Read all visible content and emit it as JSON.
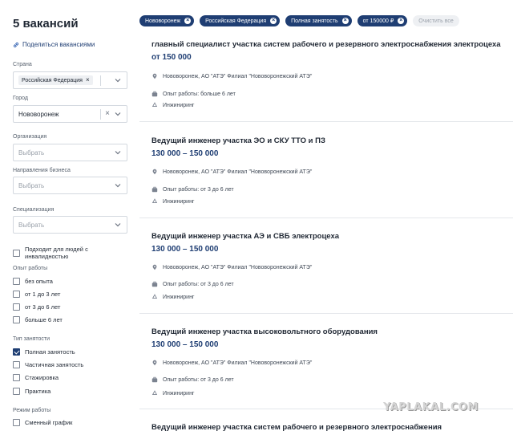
{
  "sidebar": {
    "count_title": "5 вакансий",
    "share_label": "Поделиться вакансиями",
    "country": {
      "label": "Страна",
      "chip": "Российская Федерация"
    },
    "city": {
      "label": "Город",
      "value": "Нововоронеж"
    },
    "organization": {
      "label": "Организация",
      "placeholder": "Выбрать"
    },
    "business": {
      "label": "Направления бизнеса",
      "placeholder": "Выбрать"
    },
    "specialization": {
      "label": "Специализация",
      "placeholder": "Выбрать"
    },
    "disability_label": "Подходит для людей с инвалидностью",
    "experience": {
      "title": "Опыт работы",
      "options": [
        "без опыта",
        "от 1 до 3 лет",
        "от 3 до 6 лет",
        "больше 6 лет"
      ]
    },
    "employment": {
      "title": "Тип занятости",
      "options": [
        "Полная занятость",
        "Частичная занятость",
        "Стажировка",
        "Практика"
      ]
    },
    "schedule": {
      "title": "Режим работы",
      "options": [
        "Сменный график"
      ]
    }
  },
  "chips": [
    "Нововоронеж",
    "Российская Федерация",
    "Полная занятость",
    "от 150000 ₽"
  ],
  "clear_all": "Очистить все",
  "jobs": [
    {
      "title": "главный специалист участка систем рабочего и резервного электроснабжения электроцеха",
      "salary": "от 150 000",
      "location": "Нововоронеж, АО \"АТЭ\" Филиал \"Нововоронежский АТЭ\"",
      "experience": "Опыт работы: больше 6 лет",
      "category": "Инжиниринг"
    },
    {
      "title": "Ведущий инженер участка ЭО и СКУ ТТО и ПЗ",
      "salary": "130 000 – 150 000",
      "location": "Нововоронеж, АО \"АТЭ\" Филиал \"Нововоронежский АТЭ\"",
      "experience": "Опыт работы: от 3 до 6 лет",
      "category": "Инжиниринг"
    },
    {
      "title": "Ведущий инженер участка АЭ и СВБ электроцеха",
      "salary": "130 000 – 150 000",
      "location": "Нововоронеж, АО \"АТЭ\" Филиал \"Нововоронежский АТЭ\"",
      "experience": "Опыт работы: от 3 до 6 лет",
      "category": "Инжиниринг"
    },
    {
      "title": "Ведущий инженер участка высоковольтного оборудования",
      "salary": "130 000 – 150 000",
      "location": "Нововоронеж, АО \"АТЭ\" Филиал \"Нововоронежский АТЭ\"",
      "experience": "Опыт работы: от 3 до 6 лет",
      "category": "Инжиниринг"
    },
    {
      "title": "Ведущий инженер участка систем рабочего и резервного электроснабжения"
    }
  ],
  "watermark": "YAPLAKAL.COM"
}
